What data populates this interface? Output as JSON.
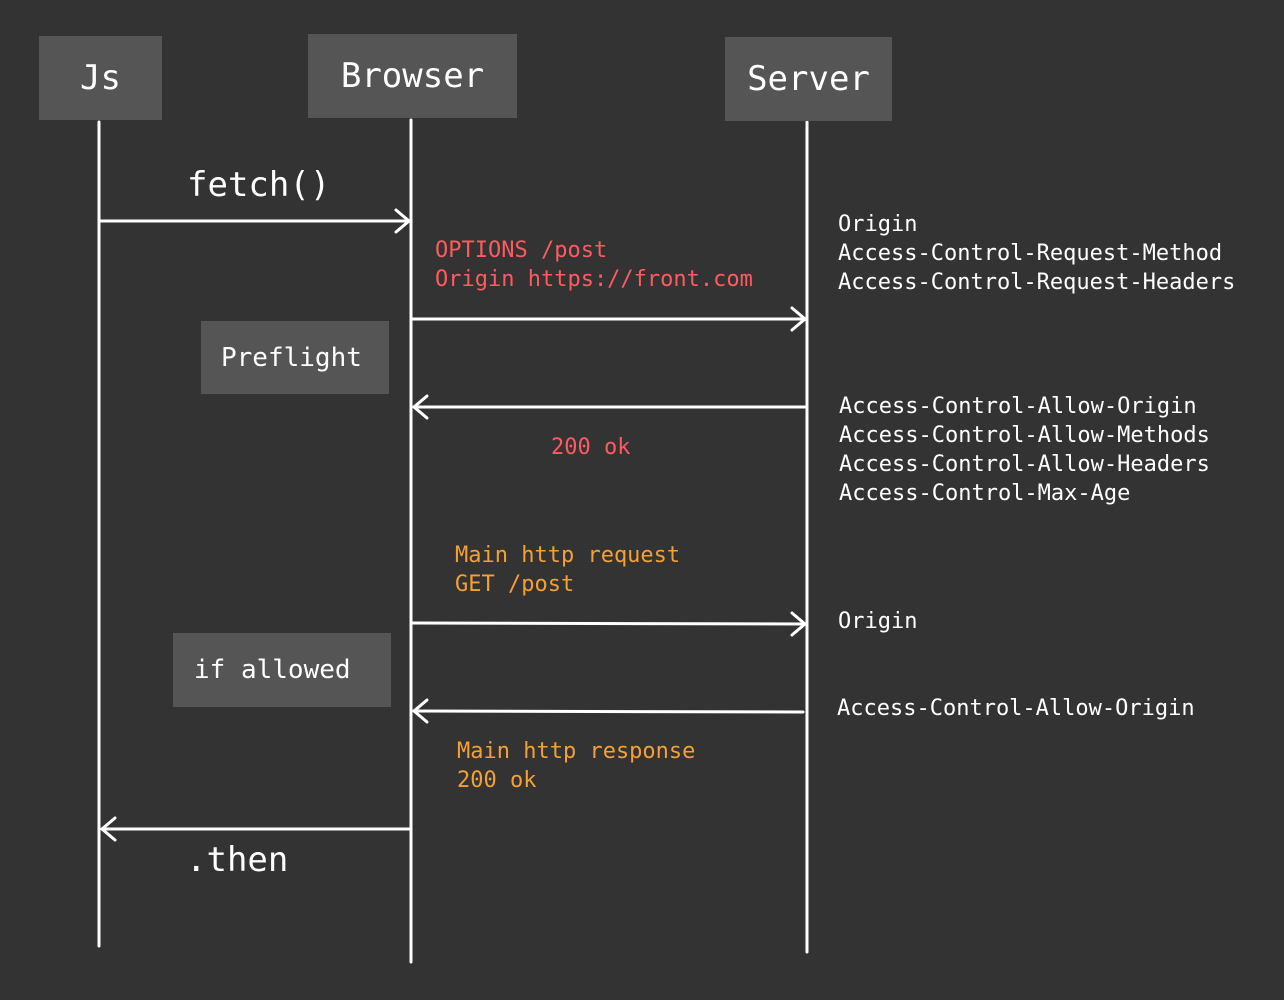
{
  "actors": {
    "js": "Js",
    "browser": "Browser",
    "server": "Server"
  },
  "calls": {
    "fetch": "fetch()",
    "then": ".then"
  },
  "notes": {
    "preflight": "Preflight",
    "if_allowed": "if allowed"
  },
  "preflight_request": {
    "line1": "OPTIONS /post",
    "line2": "Origin https://front.com"
  },
  "preflight_request_headers": [
    "Origin",
    "Access-Control-Request-Method",
    "Access-Control-Request-Headers"
  ],
  "preflight_response": {
    "status": "200 ok"
  },
  "preflight_response_headers": [
    "Access-Control-Allow-Origin",
    "Access-Control-Allow-Methods",
    "Access-Control-Allow-Headers",
    "Access-Control-Max-Age"
  ],
  "main_request": {
    "line1": "Main http request",
    "line2": "GET /post"
  },
  "main_request_headers": [
    "Origin"
  ],
  "main_response": {
    "line1": "Main http response",
    "line2": "200 ok"
  },
  "main_response_headers": [
    "Access-Control-Allow-Origin"
  ],
  "colors": {
    "background": "#333333",
    "box": "#555555",
    "line": "#ffffff",
    "preflight_text": "#ff5a5f",
    "main_text": "#f5a033"
  }
}
